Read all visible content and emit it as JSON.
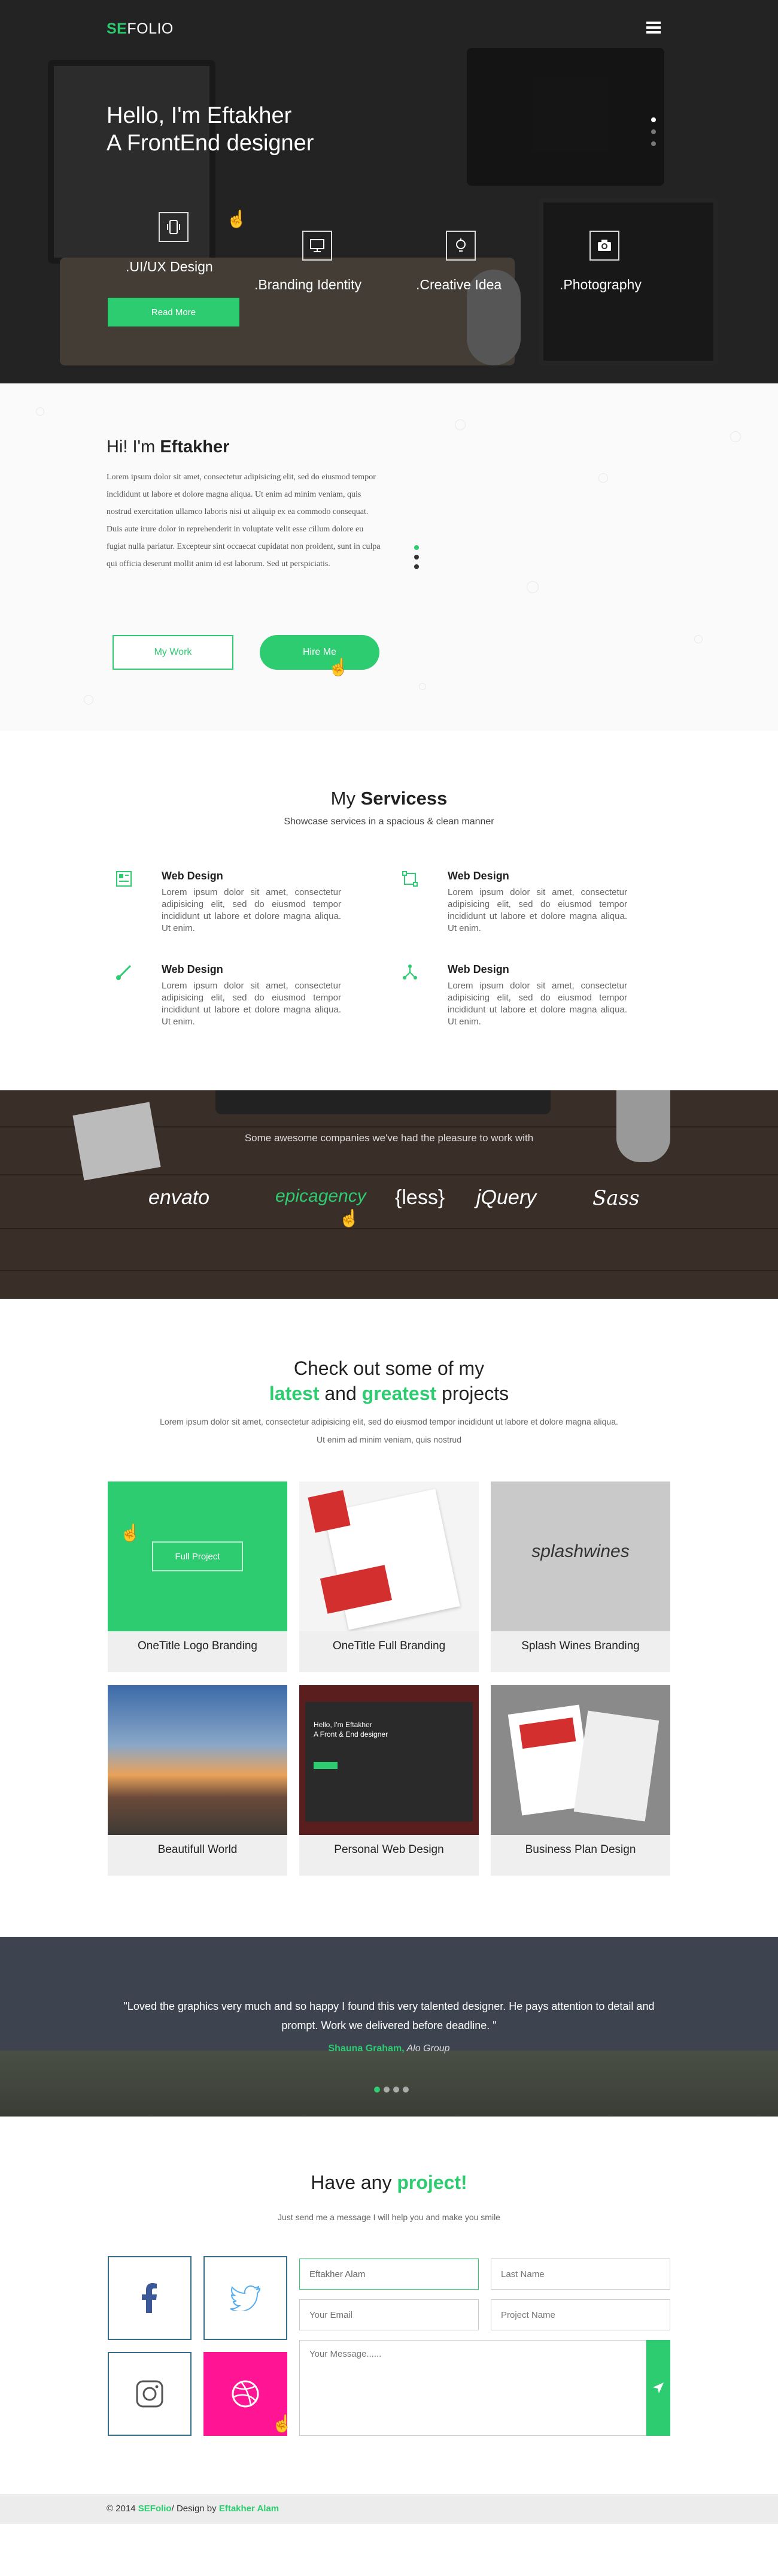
{
  "brand": {
    "logo_accent": "SE",
    "logo_rest": "FOLIO"
  },
  "colors": {
    "accent": "#2ecc71",
    "dark": "#2b2b2c",
    "pink": "#ff1493"
  },
  "hero": {
    "line1_pre": "Hello, I'm ",
    "line1_bold": "Eftakher",
    "line2_pre": "A ",
    "line2_bold": "FrontEnd",
    "line2_post": " designer",
    "services": [
      {
        "label": ".UI/UX Design",
        "icon": "mobile-icon"
      },
      {
        "label": ".Branding Identity",
        "icon": "monitor-icon"
      },
      {
        "label": ".Creative Idea",
        "icon": "bulb-icon"
      },
      {
        "label": ".Photography",
        "icon": "camera-icon"
      }
    ],
    "read_more": "Read More"
  },
  "about": {
    "heading_pre": "Hi! I'm ",
    "heading_bold": "Eftakher",
    "body": "Lorem ipsum dolor sit amet, consectetur adipisicing elit, sed do eiusmod tempor incididunt ut labore et dolore magna aliqua. Ut enim ad minim veniam, quis nostrud exercitation ullamco laboris nisi ut aliquip ex ea commodo consequat. Duis aute irure dolor in reprehenderit in voluptate velit esse cillum dolore eu fugiat nulla pariatur. Excepteur sint occaecat cupidatat non proident, sunt in culpa qui officia deserunt mollit anim id est laborum. Sed ut perspiciatis.",
    "btn_work": "My Work",
    "btn_hire": "Hire Me"
  },
  "services": {
    "title_pre": "My ",
    "title_bold": "Servicess",
    "subtitle": "Showcase services in a spacious & clean manner",
    "items": [
      {
        "title": "Web Design",
        "text": "Lorem ipsum dolor sit amet, consectetur adipisicing elit, sed do eiusmod tempor incididunt ut labore et dolore magna aliqua. Ut enim.",
        "icon": "layout-icon"
      },
      {
        "title": "Web Design",
        "text": "Lorem ipsum dolor sit amet, consectetur adipisicing elit, sed do eiusmod tempor incididunt ut labore et dolore magna aliqua. Ut enim.",
        "icon": "crop-icon"
      },
      {
        "title": "Web Design",
        "text": "Lorem ipsum dolor sit amet, consectetur adipisicing elit, sed do eiusmod tempor incididunt ut labore et dolore magna aliqua. Ut enim.",
        "icon": "brush-icon"
      },
      {
        "title": "Web Design",
        "text": "Lorem ipsum dolor sit amet, consectetur adipisicing elit, sed do eiusmod tempor incididunt ut labore et dolore magna aliqua. Ut enim.",
        "icon": "share-icon"
      }
    ]
  },
  "clients": {
    "text": "Some awesome companies we've had the pleasure to work with",
    "logos": [
      "envato",
      "epicagency",
      "{less}",
      "jQuery",
      "Sass"
    ]
  },
  "portfolio": {
    "title_line1": "Check out some of my",
    "t2_a": "latest",
    "t2_b": " and ",
    "t2_c": "greatest",
    "t2_d": " projects",
    "subtitle": "Lorem ipsum dolor sit amet, consectetur adipisicing elit, sed do eiusmod tempor incididunt ut labore et dolore magna aliqua. Ut enim ad minim veniam, quis nostrud",
    "full_project": "Full Project",
    "hero_thumb_line1": "Hello, I'm Eftakher",
    "hero_thumb_line2": "A Front & End designer",
    "splash_text": "splashwines",
    "items": [
      "OneTitle Logo Branding",
      "OneTitle Full Branding",
      "Splash Wines Branding",
      "Beautifull World",
      "Personal Web Design",
      "Business Plan Design"
    ]
  },
  "testimonial": {
    "quote": "\"Loved the graphics very much and so happy I found this very talented designer. He pays attention to detail and prompt. Work we delivered before deadline. \"",
    "author": "Shauna Graham,",
    "company": " Alo Group"
  },
  "contact": {
    "title_pre": "Have any ",
    "title_accent": "project!",
    "subtitle": "Just send me a message I will help you and make you smile",
    "first_value": "Eftakher Alam",
    "last_placeholder": "Last Name",
    "email_placeholder": "Your Email",
    "project_placeholder": "Project Name",
    "message_placeholder": "Your Message......"
  },
  "footer": {
    "pre": "© 2014 ",
    "brand": "SEFolio",
    "mid": "/ Design by ",
    "author": "Eftakher Alam"
  }
}
